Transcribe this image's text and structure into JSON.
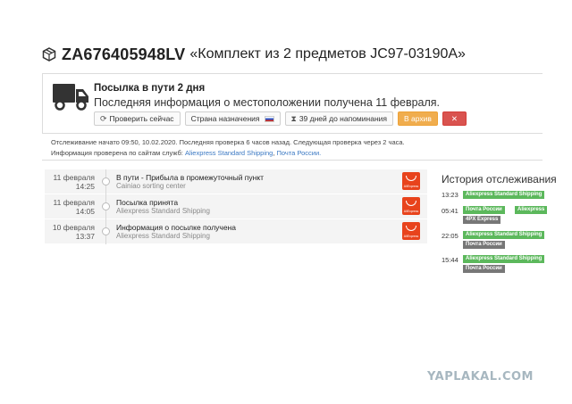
{
  "header": {
    "tracking_code": "ZA676405948LV",
    "item_name": "«Комплект из 2 предметов JC97-03190A»"
  },
  "status": {
    "title": "Посылка в пути 2 дня",
    "text": "Последняя информация о местоположении получена 11 февраля.",
    "buttons": {
      "check_now": "Проверить сейчас",
      "destination": "Страна назначения",
      "reminder": "39 дней до напоминания",
      "archive": "В архив",
      "delete": "✕"
    }
  },
  "info": {
    "line1": "Отслеживание начато 09:50, 10.02.2020. Последняя проверка 6 часов назад. Следующая проверка через 2 часа.",
    "line2_prefix": "Информация проверена по сайтам служб:",
    "service1": "Aliexpress Standard Shipping",
    "service2": "Почта России."
  },
  "events": [
    {
      "date": "11 февраля",
      "time": "14:25",
      "title": "В пути - Прибыла в промежуточный пункт",
      "subtitle": "Cainiao sorting center",
      "logo_text": "AliExpress"
    },
    {
      "date": "11 февраля",
      "time": "14:05",
      "title": "Посылка принята",
      "subtitle": "Aliexpress Standard Shipping",
      "logo_text": "AliExpress"
    },
    {
      "date": "10 февраля",
      "time": "13:37",
      "title": "Информация о посылке получена",
      "subtitle": "Aliexpress Standard Shipping",
      "logo_text": "AliExpress"
    }
  ],
  "history": {
    "title": "История отслеживания",
    "rows": [
      {
        "time": "13:23",
        "tags": [
          "Aliexpress Standard Shipping"
        ]
      },
      {
        "time": "05:41",
        "tags": [
          "Почта России",
          "Aliexpress",
          "4PX Express"
        ]
      },
      {
        "time": "22:05",
        "tags": [
          "Aliexpress Standard Shipping",
          "Почта России"
        ]
      },
      {
        "time": "15:44",
        "tags": [
          "Aliexpress Standard Shipping",
          "Почта России"
        ]
      }
    ]
  },
  "watermark": "YAPLAKAL.COM",
  "colors": {
    "archive": "#f0ad4e",
    "delete": "#d9534f",
    "tag_green": "#5cb85c",
    "tag_grey": "#777777",
    "link": "#3a78c3",
    "aliexpress": "#e8431c"
  }
}
